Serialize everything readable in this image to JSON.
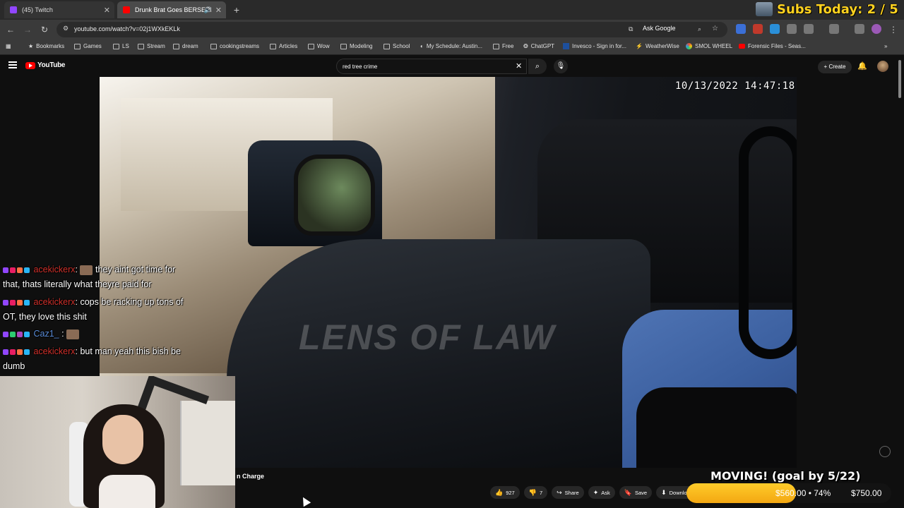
{
  "browser": {
    "tabs": [
      {
        "title": "(45) Twitch",
        "active": false,
        "favicon_color": "#9146ff"
      },
      {
        "title": "Drunk Brat Goes BERSERK W",
        "active": true,
        "favicon_color": "#ff0000"
      }
    ],
    "url": "youtube.com/watch?v=02j1WXkEKLk",
    "ask_google": "Ask Google",
    "bookmarks": [
      "Bookmarks",
      "Games",
      "LS",
      "Stream",
      "dream",
      "cookingstreams",
      "Articles",
      "Wow",
      "Modeling",
      "School",
      "My Schedule: Austin...",
      "Free",
      "ChatGPT",
      "Invesco - Sign in for...",
      "WeatherWise",
      "SMOL WHEEL",
      "Forensic Files - Seas..."
    ]
  },
  "overlay": {
    "subs_today": "Subs Today: 2 / 5",
    "goal_title": "MOVING! (goal by 5/22)",
    "goal_current": "$560.00 • 74%",
    "goal_target": "$750.00",
    "goal_progress_pct": 74,
    "goal_color": "#f3a712"
  },
  "youtube": {
    "logo": "YouTube",
    "search_query": "red tree crime",
    "create_label": "Create",
    "video_timestamp": "10/13/2022 14:47:18",
    "watermark": "LENS OF LAW",
    "title_fragment": "n Charge",
    "actions": {
      "likes": "927",
      "dislikes": "7",
      "share": "Share",
      "ask": "Ask",
      "save": "Save",
      "download": "Download"
    }
  },
  "chat": [
    {
      "user": "acekickerx",
      "message": "they aint got time for",
      "continuation": "that, thats literally what theyre paid for",
      "user_color": "#d0302a"
    },
    {
      "user": "acekickerx",
      "message": "cops be racking up tons of",
      "continuation": "OT, they love this shit",
      "user_color": "#d0302a"
    },
    {
      "user": "Caz1_",
      "message": "",
      "continuation": "",
      "user_color": "#5a8bd6"
    },
    {
      "user": "acekickerx",
      "message": "but man yeah this bish be",
      "continuation": "dumb",
      "user_color": "#d0302a"
    }
  ]
}
